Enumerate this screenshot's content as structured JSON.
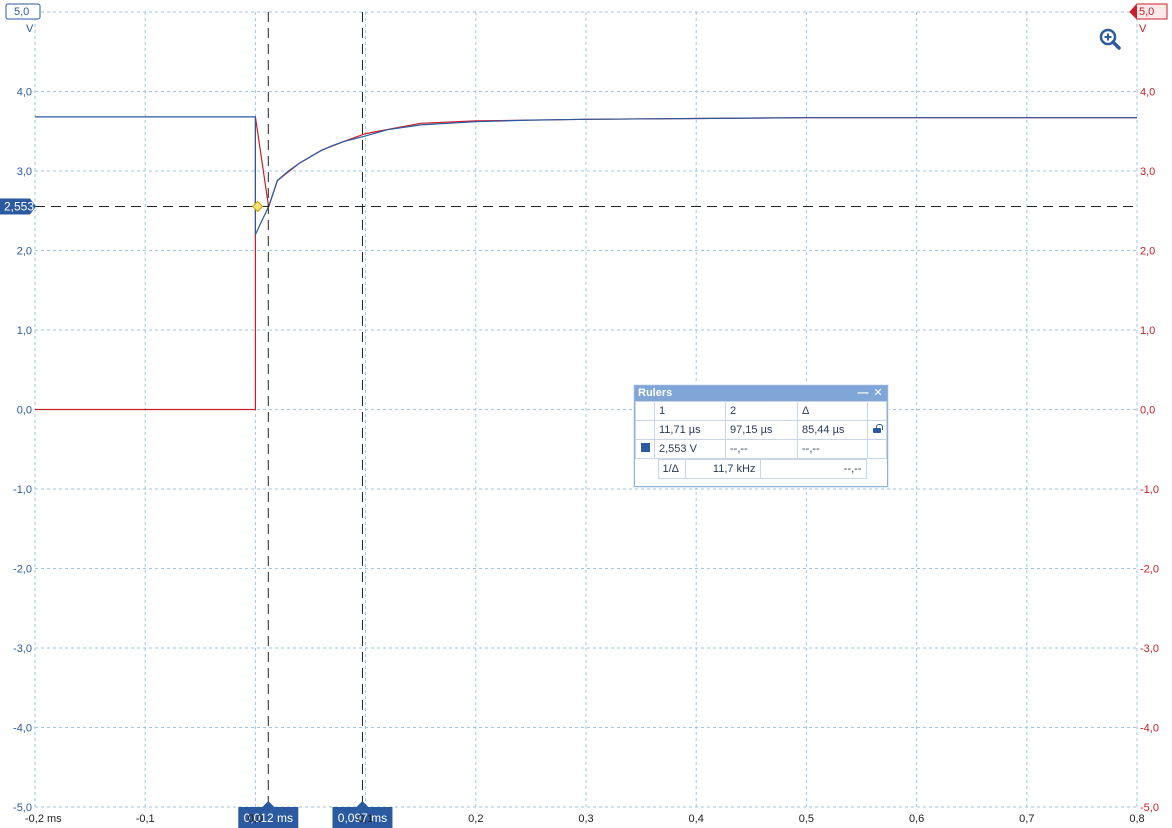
{
  "chart_data": {
    "type": "line",
    "x_axis": {
      "ticks": [
        -0.2,
        -0.1,
        0.0,
        0.1,
        0.2,
        0.3,
        0.4,
        0.5,
        0.6,
        0.7,
        0.8
      ],
      "tick_labels": [
        "-0,2 ms",
        "-0,1",
        "0,0",
        "0,1",
        "0,2",
        "0,3",
        "0,4",
        "0,5",
        "0,6",
        "0,7",
        "0,8"
      ],
      "xlim": [
        -0.2,
        0.8
      ]
    },
    "y_axis_left": {
      "ylim": [
        -5.0,
        5.0
      ],
      "ticks": [
        -5,
        -4,
        -3,
        -2,
        -1,
        0,
        1,
        2,
        3,
        4,
        5
      ],
      "tick_labels": [
        "-5,0",
        "-4,0",
        "-3,0",
        "-2,0",
        "-1,0",
        "0,0",
        "1,0",
        "2,0",
        "3,0",
        "4,0",
        "5,0"
      ],
      "unit": "V",
      "color": "#2b5aa0"
    },
    "y_axis_right": {
      "ylim": [
        -5.0,
        5.0
      ],
      "ticks": [
        -5,
        -4,
        -3,
        -2,
        -1,
        0,
        1,
        2,
        3,
        4,
        5
      ],
      "tick_labels": [
        "-5,0",
        "-4,0",
        "-3,0",
        "-2,0",
        "-1,0",
        "0,0",
        "1,0",
        "2,0",
        "3,0",
        "4,0",
        "5,0"
      ],
      "unit": "V",
      "color": "#c8202a"
    },
    "grid": true,
    "series": [
      {
        "color": "#2b5aa0",
        "x": [
          -0.2,
          -0.1,
          0.0,
          0.0,
          0.005,
          0.012,
          0.02,
          0.03,
          0.04,
          0.05,
          0.06,
          0.07,
          0.08,
          0.097,
          0.12,
          0.15,
          0.2,
          0.25,
          0.3,
          0.4,
          0.5,
          0.6,
          0.7,
          0.8
        ],
        "y": [
          3.68,
          3.68,
          3.68,
          2.2,
          2.35,
          2.55,
          2.88,
          3.0,
          3.1,
          3.18,
          3.26,
          3.32,
          3.37,
          3.43,
          3.52,
          3.58,
          3.62,
          3.64,
          3.65,
          3.66,
          3.67,
          3.67,
          3.67,
          3.67
        ]
      },
      {
        "color": "#c8202a",
        "x": [
          -0.2,
          -0.1,
          -0.001,
          0.0,
          0.0,
          0.012,
          0.02,
          0.04,
          0.06,
          0.08,
          0.1,
          0.15,
          0.2,
          0.3,
          0.4,
          0.5,
          0.6,
          0.7,
          0.8
        ],
        "y": [
          0.0,
          0.0,
          0.0,
          0.0,
          3.68,
          2.55,
          2.88,
          3.1,
          3.26,
          3.37,
          3.47,
          3.6,
          3.63,
          3.65,
          3.66,
          3.67,
          3.67,
          3.67,
          3.67
        ]
      }
    ],
    "horizontal_ruler": {
      "y": 2.553,
      "label": "2,553"
    },
    "vertical_rulers": [
      {
        "x": 0.01171,
        "label": "0,012 ms"
      },
      {
        "x": 0.09715,
        "label": "0,097 ms"
      }
    ]
  },
  "top_left_badge": "5,0",
  "top_right_badge": "5,0",
  "rulers_panel": {
    "title": "Rulers",
    "minimize_label": "—",
    "close_label": "✕",
    "header": [
      "",
      "1",
      "2",
      "Δ"
    ],
    "time_row": [
      "11,71 µs",
      "97,15 µs",
      "85,44 µs"
    ],
    "volt_row": [
      "2,553 V",
      "--,--",
      "--,--"
    ],
    "freq_label": "1/Δ",
    "freq_value": "11,7 kHz",
    "freq_other": "--,--"
  },
  "icons": {
    "zoom": "zoom-in-icon",
    "lock": "unlock-icon",
    "swatch": "channel-swatch-icon"
  }
}
